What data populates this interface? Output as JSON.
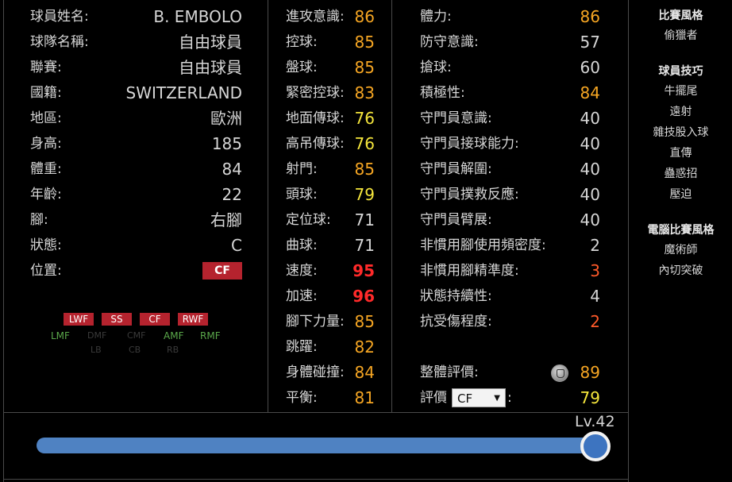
{
  "profile": [
    {
      "label": "球員姓名:",
      "value": "B. EMBOLO"
    },
    {
      "label": "球隊名稱:",
      "value": "自由球員"
    },
    {
      "label": "聯賽:",
      "value": "自由球員"
    },
    {
      "label": "國籍:",
      "value": "SWITZERLAND"
    },
    {
      "label": "地區:",
      "value": "歐洲"
    },
    {
      "label": "身高:",
      "value": "185"
    },
    {
      "label": "體重:",
      "value": "84"
    },
    {
      "label": "年齡:",
      "value": "22"
    },
    {
      "label": "腳:",
      "value": "右腳"
    },
    {
      "label": "狀態:",
      "value": "C"
    }
  ],
  "position": {
    "label": "位置:",
    "value": "CF"
  },
  "position_map": {
    "chips": [
      "LWF",
      "SS",
      "CF",
      "RWF"
    ],
    "green": [
      "LMF",
      "AMF",
      "RMF"
    ],
    "dim": [
      "DMF",
      "CMF",
      "LB",
      "CB",
      "RB"
    ]
  },
  "stats_mid": [
    {
      "label": "進攻意識:",
      "value": "86",
      "tone": "orange"
    },
    {
      "label": "控球:",
      "value": "85",
      "tone": "orange"
    },
    {
      "label": "盤球:",
      "value": "85",
      "tone": "orange"
    },
    {
      "label": "緊密控球:",
      "value": "83",
      "tone": "orange"
    },
    {
      "label": "地面傳球:",
      "value": "76",
      "tone": "yellow"
    },
    {
      "label": "高吊傳球:",
      "value": "76",
      "tone": "yellow"
    },
    {
      "label": "射門:",
      "value": "85",
      "tone": "orange"
    },
    {
      "label": "頭球:",
      "value": "79",
      "tone": "yellow"
    },
    {
      "label": "定位球:",
      "value": "71",
      "tone": "white"
    },
    {
      "label": "曲球:",
      "value": "71",
      "tone": "white"
    },
    {
      "label": "速度:",
      "value": "95",
      "tone": "red"
    },
    {
      "label": "加速:",
      "value": "96",
      "tone": "red"
    },
    {
      "label": "腳下力量:",
      "value": "85",
      "tone": "orange"
    },
    {
      "label": "跳躍:",
      "value": "82",
      "tone": "orange"
    },
    {
      "label": "身體碰撞:",
      "value": "84",
      "tone": "orange"
    },
    {
      "label": "平衡:",
      "value": "81",
      "tone": "orange"
    }
  ],
  "stats_right": [
    {
      "label": "體力:",
      "value": "86",
      "tone": "orange"
    },
    {
      "label": "防守意識:",
      "value": "57",
      "tone": "white"
    },
    {
      "label": "搶球:",
      "value": "60",
      "tone": "white"
    },
    {
      "label": "積極性:",
      "value": "84",
      "tone": "orange"
    },
    {
      "label": "守門員意識:",
      "value": "40",
      "tone": "white"
    },
    {
      "label": "守門員接球能力:",
      "value": "40",
      "tone": "white"
    },
    {
      "label": "守門員解圍:",
      "value": "40",
      "tone": "white"
    },
    {
      "label": "守門員撲救反應:",
      "value": "40",
      "tone": "white"
    },
    {
      "label": "守門員臂展:",
      "value": "40",
      "tone": "white"
    },
    {
      "label": "非慣用腳使用頻密度:",
      "value": "2",
      "tone": "white"
    },
    {
      "label": "非慣用腳精準度:",
      "value": "3",
      "tone": "red2"
    },
    {
      "label": "狀態持續性:",
      "value": "4",
      "tone": "white"
    },
    {
      "label": "抗受傷程度:",
      "value": "2",
      "tone": "red2"
    }
  ],
  "overall": {
    "label": "整體評價:",
    "value": "89",
    "medal_icon": "medal-icon"
  },
  "rating": {
    "label": "評價",
    "select_value": "CF",
    "colon": ":",
    "value": "79"
  },
  "side": {
    "style_heading": "比賽風格",
    "style_items": [
      "偷獵者"
    ],
    "skills_heading": "球員技巧",
    "skills_items": [
      "牛擺尾",
      "遠射",
      "雜技股入球",
      "直傳",
      "蠱惑招",
      "壓迫"
    ],
    "com_heading": "電腦比賽風格",
    "com_items": [
      "魔術師",
      "內切突破"
    ]
  },
  "level": {
    "label": "Lv.42",
    "fraction": 1.0
  },
  "colors": {
    "orange": "#f6a623",
    "yellow": "#f5e63c",
    "red": "#ff2a2a",
    "badge": "#b5232e",
    "slider": "#4f82c2"
  }
}
